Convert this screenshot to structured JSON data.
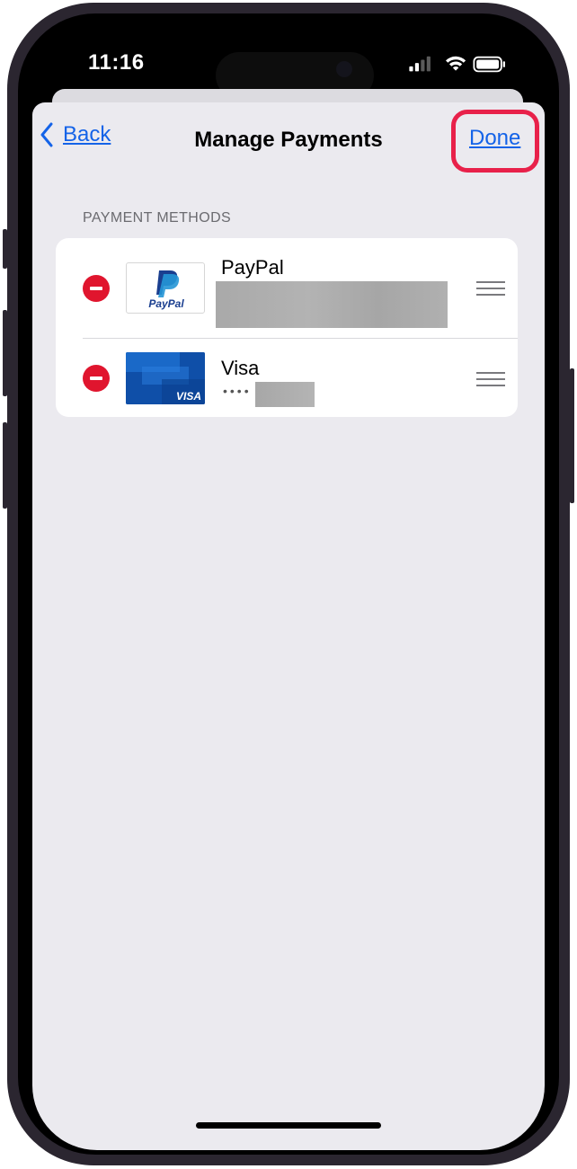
{
  "status_bar": {
    "time": "11:16",
    "icons": [
      "cellular-signal-icon",
      "wifi-icon",
      "battery-icon"
    ]
  },
  "nav": {
    "back_label": "Back",
    "title": "Manage Payments",
    "done_label": "Done"
  },
  "section": {
    "header": "PAYMENT METHODS"
  },
  "payment_methods": [
    {
      "name": "PayPal",
      "logo": "paypal-logo",
      "detail": "redacted"
    },
    {
      "name": "Visa",
      "logo": "visa-card",
      "detail_prefix": "••••"
    }
  ],
  "paypal_logo_text": "PayPal",
  "visa_logo_text": "VISA",
  "colors": {
    "accent": "#1463e8",
    "delete": "#e0152e",
    "highlight": "#e8214a",
    "background": "#ebeaef"
  }
}
